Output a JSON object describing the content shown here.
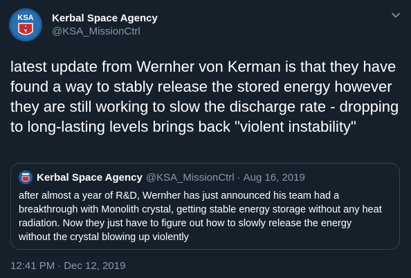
{
  "colors": {
    "background": "#15202b",
    "text_primary": "#ffffff",
    "text_secondary": "#8899a6",
    "border": "#38444d",
    "avatar_blue": "#1b5e9e",
    "avatar_red": "#e0261b"
  },
  "tweet": {
    "author_name": "Kerbal Space Agency",
    "author_handle": "@KSA_MissionCtrl",
    "avatar_text": "KSA",
    "avatar_icon": "ksa-logo-icon",
    "menu_icon": "chevron-down-icon",
    "text": "latest update from Wernher von Kerman is that they have found a way to stably release the stored energy however they are still working to slow the discharge rate - dropping to long-lasting levels brings back \"violent instability\"",
    "time": "12:41 PM",
    "separator": "·",
    "date": "Dec 12, 2019"
  },
  "quoted_tweet": {
    "author_name": "Kerbal Space Agency",
    "author_handle": "@KSA_MissionCtrl",
    "separator": "·",
    "date": "Aug 16, 2019",
    "text": "after almost a year of R&D, Wernher has just announced his team had a breakthrough with Monolith crystal, getting stable energy storage without any heat radiation. Now they just have to figure out how to slowly release the energy without the crystal blowing up violently"
  }
}
